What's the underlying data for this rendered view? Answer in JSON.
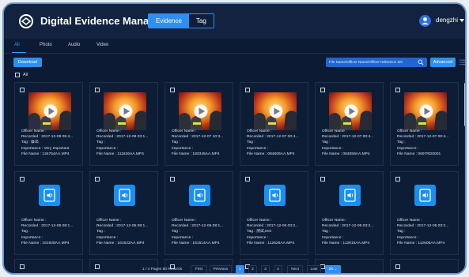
{
  "app": {
    "title": "Digital Evidence Management",
    "mode_tabs": [
      {
        "label": "Evidence",
        "active": true
      },
      {
        "label": "Tag",
        "active": false
      }
    ],
    "user": "dengzhi"
  },
  "media_tabs": [
    {
      "label": "All",
      "active": true
    },
    {
      "label": "Photo",
      "active": false
    },
    {
      "label": "Audio",
      "active": false
    },
    {
      "label": "Video",
      "active": false
    }
  ],
  "toolbar": {
    "download_label": "Download",
    "search_placeholder": "File Name/Officer Name/Officer ID/Device SN",
    "advanced_label": "Advanced"
  },
  "select_all_label": "All",
  "cards": [
    {
      "type": "video",
      "officer": "Officer Name :",
      "recorded": "Recorded : 2017-12-08 05:4...",
      "tag": "Tag : 蔡出",
      "importance": "Importance : Very Important",
      "file": "File Name : 134754AA.MP4"
    },
    {
      "type": "video",
      "officer": "Officer Name :",
      "recorded": "Recorded : 2017-12-08 03:1...",
      "tag": "Tag :",
      "importance": "Importance :",
      "file": "File Name : 111626AA.MP4"
    },
    {
      "type": "video",
      "officer": "Officer Name :",
      "recorded": "Recorded : 2017-12-07 10:3...",
      "tag": "Tag :",
      "importance": "Importance :",
      "file": "File Name : 183345AA.MP4"
    },
    {
      "type": "video",
      "officer": "Officer Name :",
      "recorded": "Recorded : 2017-12-07 00:4...",
      "tag": "Tag :",
      "importance": "Importance :",
      "file": "File Name : 084606AA.MP4"
    },
    {
      "type": "video",
      "officer": "Officer Name :",
      "recorded": "Recorded : 2017-12-07 00:4...",
      "tag": "Tag :",
      "importance": "Importance :",
      "file": "File Name : 084559AA.MP4"
    },
    {
      "type": "video",
      "officer": "Officer Name :",
      "recorded": "Recorded : 2017-12-07 00:4...",
      "tag": "Tag :",
      "importance": "Importance :",
      "file": "File Name : 0607RD0001"
    },
    {
      "type": "audio",
      "officer": "Officer Name :",
      "recorded": "Recorded : 2017-12-05 08:1...",
      "tag": "Tag :",
      "importance": "Importance :",
      "file": "File Name : 161928AA.MP4"
    },
    {
      "type": "audio",
      "officer": "Officer Name :",
      "recorded": "Recorded : 2017-12-05 08:1...",
      "tag": "Tag :",
      "importance": "Importance :",
      "file": "File Name : 161522AA.MP4"
    },
    {
      "type": "audio",
      "officer": "Officer Name :",
      "recorded": "Recorded : 2017-12-05 08:1...",
      "tag": "Tag :",
      "importance": "Importance :",
      "file": "File Name : 161514AA.MP4"
    },
    {
      "type": "audio",
      "officer": "Officer Name :",
      "recorded": "Recorded : 2017-12-05 03:2...",
      "tag": "Tag : 测试,test",
      "importance": "Importance :",
      "file": "File Name : 112626AA.MP4"
    },
    {
      "type": "audio",
      "officer": "Officer Name :",
      "recorded": "Recorded : 2017-12-05 03:2...",
      "tag": "Tag :",
      "importance": "Importance :",
      "file": "File Name : 112615AA.MP4"
    },
    {
      "type": "audio",
      "officer": "Officer Name :",
      "recorded": "Recorded : 2017-12-05 03:2...",
      "tag": "Tag :",
      "importance": "Importance :",
      "file": "File Name : 112606AA.MP4"
    }
  ],
  "pagination": {
    "summary": "1 / 4 Pages 80 Records",
    "first": "First",
    "previous": "Previous",
    "pages": [
      "1",
      "2",
      "3",
      "4"
    ],
    "current": "1",
    "next": "Next",
    "last": "Last",
    "page_size": "25 ⌄"
  },
  "colors": {
    "accent": "#2f8ff0",
    "background": "#0c1b33",
    "header": "#13233f"
  }
}
